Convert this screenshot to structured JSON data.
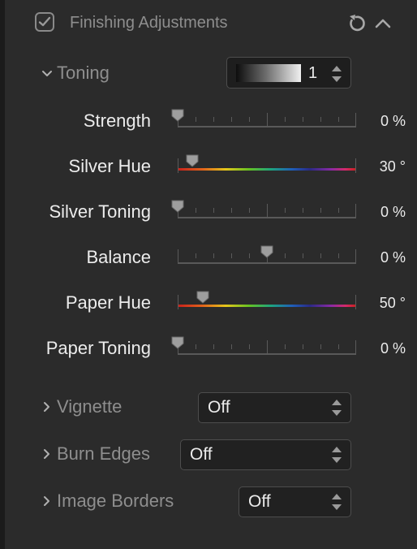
{
  "header": {
    "title": "Finishing Adjustments",
    "enabled": true
  },
  "toning": {
    "label": "Toning",
    "preset_value": "1",
    "sliders": [
      {
        "label": "Strength",
        "value_text": "0 %",
        "position": 0.0,
        "type": "plain"
      },
      {
        "label": "Silver Hue",
        "value_text": "30 °",
        "position": 0.08,
        "type": "hue"
      },
      {
        "label": "Silver Toning",
        "value_text": "0 %",
        "position": 0.0,
        "type": "plain"
      },
      {
        "label": "Balance",
        "value_text": "0 %",
        "position": 0.5,
        "type": "plain"
      },
      {
        "label": "Paper Hue",
        "value_text": "50 °",
        "position": 0.14,
        "type": "hue"
      },
      {
        "label": "Paper Toning",
        "value_text": "0 %",
        "position": 0.0,
        "type": "plain"
      }
    ]
  },
  "sections": [
    {
      "label": "Vignette",
      "value": "Off"
    },
    {
      "label": "Burn Edges",
      "value": "Off"
    },
    {
      "label": "Image Borders",
      "value": "Off"
    }
  ],
  "colors": {
    "panel": "#2b2b2b",
    "text_primary": "#ececec",
    "text_secondary": "#8e8e8e"
  }
}
